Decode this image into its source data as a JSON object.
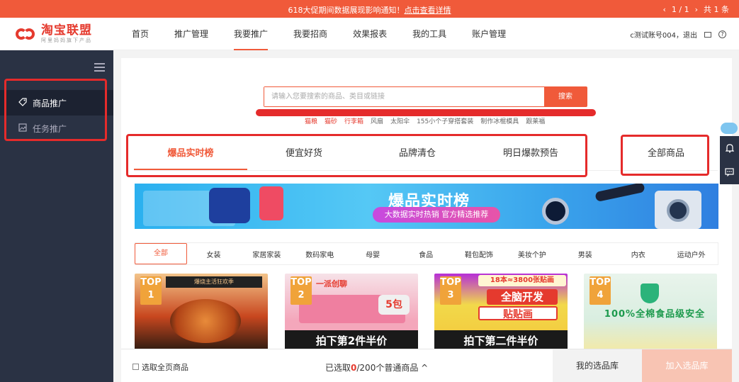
{
  "notice": {
    "message": "618大促期间数据展现影响通知！",
    "link": "点击查看详情",
    "pager": "1 / 1",
    "total": "共 1 条"
  },
  "header": {
    "logo_title": "淘宝联盟",
    "logo_subtitle": "阿里妈妈旗下产品",
    "nav": [
      "首页",
      "推广管理",
      "我要推广",
      "我要招商",
      "效果报表",
      "我的工具",
      "账户管理"
    ],
    "active_nav": "我要推广",
    "user": "c测试账号004，退出"
  },
  "sidebar": {
    "items": [
      {
        "label": "商品推广",
        "icon": "tag-icon",
        "active": true
      },
      {
        "label": "任务推广",
        "icon": "picture-icon",
        "active": false
      }
    ]
  },
  "search": {
    "placeholder": "请输入您要搜索的商品、类目或链接",
    "button": "搜索",
    "hot_words": [
      "猫粮",
      "猫砂",
      "行李箱",
      "风扇",
      "太阳伞",
      "155小个子穿搭套装",
      "制作冰棍模具",
      "跟莱福"
    ]
  },
  "tabs": [
    "爆品实时榜",
    "便宜好货",
    "品牌清仓",
    "明日爆款预告"
  ],
  "tab_all": "全部商品",
  "banner": {
    "title": "爆品实时榜",
    "subtitle": "大数据实时热销 官方精选推荐"
  },
  "categories": [
    "全部",
    "女装",
    "家居家装",
    "数码家电",
    "母婴",
    "食品",
    "鞋包配饰",
    "美妆个护",
    "男装",
    "内衣",
    "运动户外"
  ],
  "products": [
    {
      "rank": "TOP 1",
      "badge": "爆烧主活狂欢季",
      "slogan": ""
    },
    {
      "rank": "TOP 2",
      "brand": "一派创聊",
      "pack": "5包",
      "slogan": "拍下第2件半价"
    },
    {
      "rank": "TOP 3",
      "header": "18本≈3800张贴画",
      "title1": "全脑开发",
      "title2": "贴贴画",
      "slogan": "拍下第二件半价"
    },
    {
      "rank": "TOP 4",
      "slogan_text": "100%全棉食品级安全"
    }
  ],
  "bottom": {
    "select_all": "选取全页商品",
    "selected_prefix": "已选取",
    "selected_count": "0",
    "selected_suffix": "/200个普通商品",
    "library": "我的选品库",
    "add": "加入选品库"
  },
  "colors": {
    "accent": "#f05a3a",
    "sidebar": "#2a3244",
    "annotation": "#e52b2b"
  }
}
